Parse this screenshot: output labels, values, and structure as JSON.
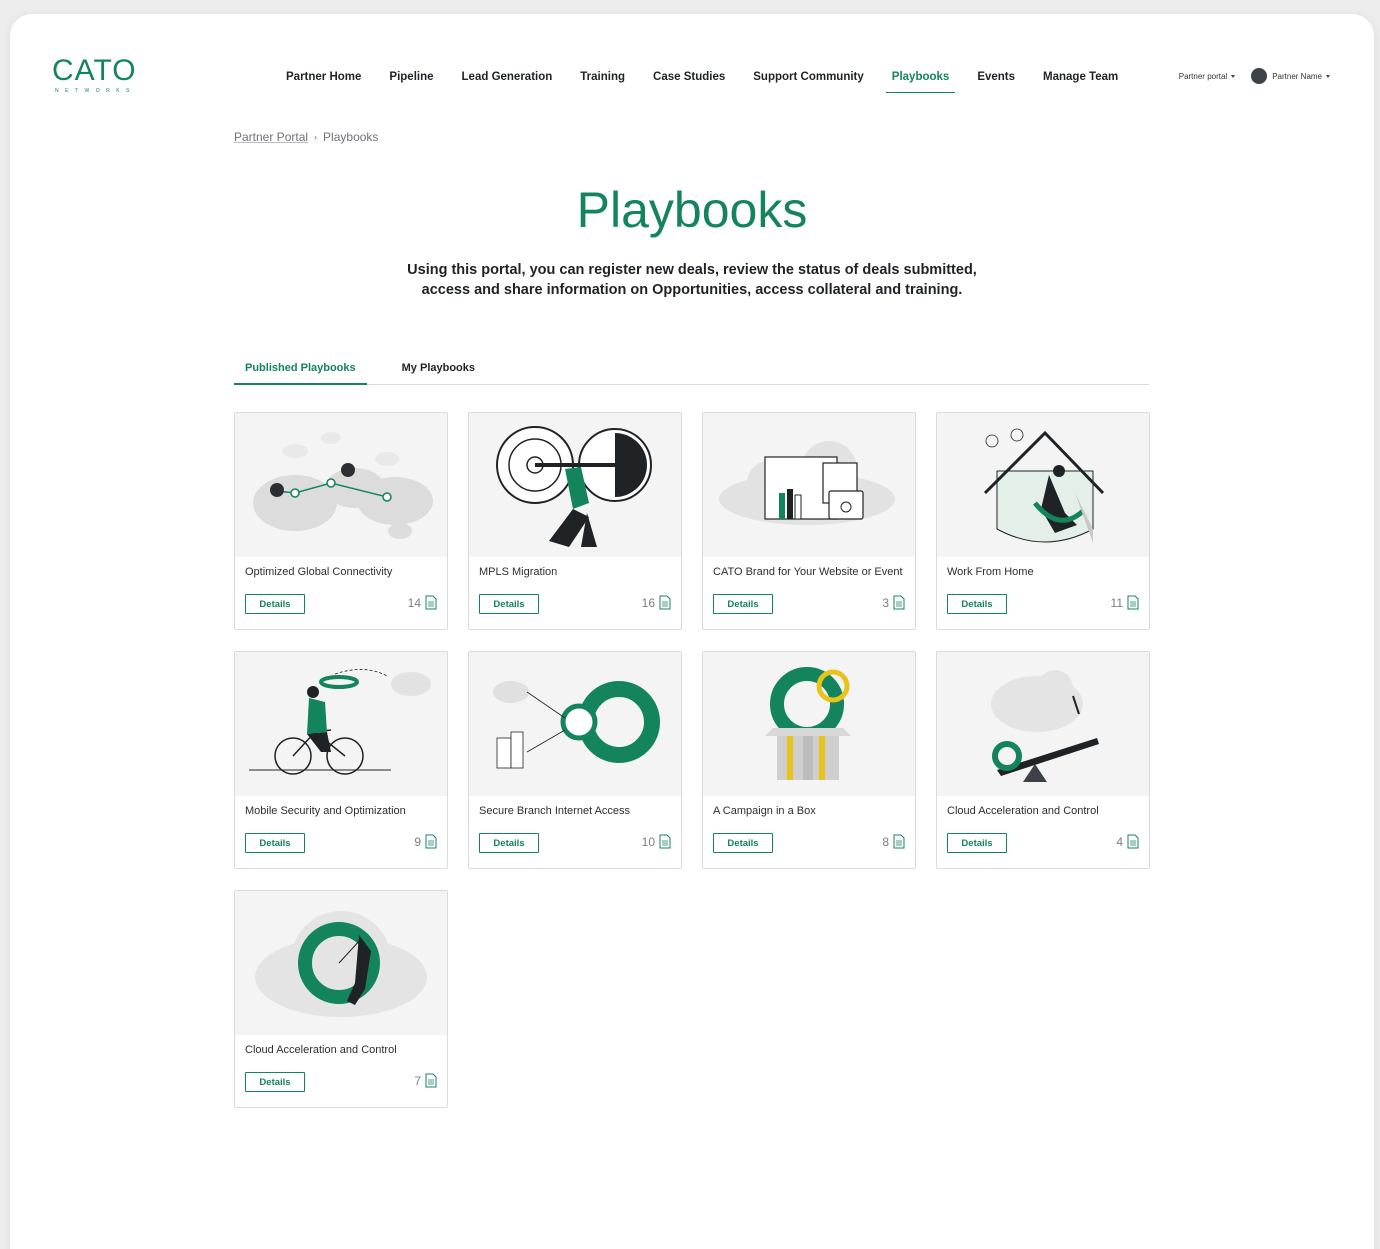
{
  "brand": {
    "name": "CATO",
    "subname": "NETWORKS",
    "accent": "#13845c"
  },
  "nav": [
    {
      "label": "Partner Home"
    },
    {
      "label": "Pipeline"
    },
    {
      "label": "Lead Generation"
    },
    {
      "label": "Training"
    },
    {
      "label": "Case Studies"
    },
    {
      "label": "Support Community"
    },
    {
      "label": "Playbooks",
      "active": true
    },
    {
      "label": "Events"
    },
    {
      "label": "Manage Team"
    }
  ],
  "header": {
    "portal_menu": "Partner portal",
    "user_menu": "Partner Name"
  },
  "breadcrumb": {
    "root": "Partner Portal",
    "separator": "›",
    "current": "Playbooks"
  },
  "page": {
    "title": "Playbooks",
    "intro_line1": "Using this portal, you can register new deals, review the status of deals submitted,",
    "intro_line2": "access and share information on Opportunities, access collateral and training."
  },
  "tabs": [
    {
      "label": "Published Playbooks",
      "active": true
    },
    {
      "label": "My Playbooks"
    }
  ],
  "details_label": "Details",
  "cards": [
    {
      "title": "Optimized Global Connectivity",
      "count": "14",
      "icon": "world-map-illustration"
    },
    {
      "title": "MPLS Migration",
      "count": "16",
      "icon": "weightlifter-illustration"
    },
    {
      "title": "CATO Brand for Your Website or Event",
      "count": "3",
      "icon": "brand-assets-illustration"
    },
    {
      "title": "Work From Home",
      "count": "11",
      "icon": "home-worker-illustration"
    },
    {
      "title": "Mobile Security and Optimization",
      "count": "9",
      "icon": "cyclist-illustration"
    },
    {
      "title": "Secure Branch Internet Access",
      "count": "10",
      "icon": "branch-ring-illustration"
    },
    {
      "title": "A Campaign in a Box",
      "count": "8",
      "icon": "gift-box-illustration"
    },
    {
      "title": "Cloud Acceleration and Control",
      "count": "4",
      "icon": "seesaw-illustration"
    },
    {
      "title": "Cloud Acceleration and Control",
      "count": "7",
      "icon": "speed-ring-illustration"
    }
  ]
}
